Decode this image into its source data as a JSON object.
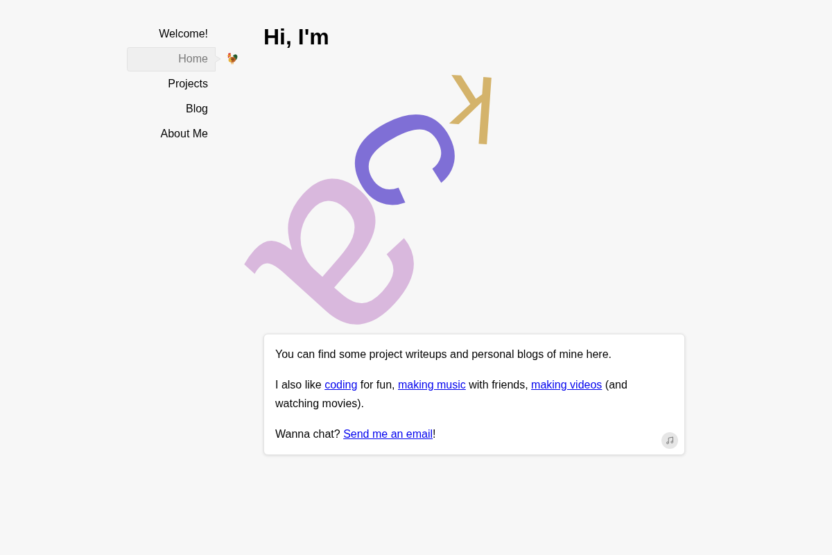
{
  "nav": {
    "items": [
      {
        "label": "Welcome!",
        "selected": false
      },
      {
        "label": "Home",
        "selected": true
      },
      {
        "label": "Projects",
        "selected": false
      },
      {
        "label": "Blog",
        "selected": false
      },
      {
        "label": "About Me",
        "selected": false
      }
    ]
  },
  "heading": "Hi, I'm",
  "letters": [
    {
      "text": "a",
      "color": "#d9b8dd"
    },
    {
      "text": "c",
      "color": "#7f6fd6"
    },
    {
      "text": "k",
      "color": "#d4b36b"
    }
  ],
  "card": {
    "paragraphs": [
      {
        "segments": [
          {
            "kind": "text",
            "text": "You can find some project writeups and personal blogs of mine here."
          }
        ]
      },
      {
        "segments": [
          {
            "kind": "text",
            "text": "I also like "
          },
          {
            "kind": "link",
            "text": "coding"
          },
          {
            "kind": "text",
            "text": " for fun, "
          },
          {
            "kind": "link",
            "text": "making music"
          },
          {
            "kind": "text",
            "text": " with friends, "
          },
          {
            "kind": "link",
            "text": "making videos"
          },
          {
            "kind": "text",
            "text": " (and watching movies)."
          }
        ]
      },
      {
        "segments": [
          {
            "kind": "text",
            "text": "Wanna chat? "
          },
          {
            "kind": "link",
            "text": "Send me an email"
          },
          {
            "kind": "text",
            "text": "!"
          }
        ]
      }
    ]
  }
}
